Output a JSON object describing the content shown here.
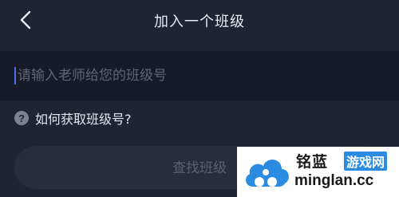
{
  "header": {
    "title": "加入一个班级",
    "back_icon": "chevron-left-icon"
  },
  "class_input": {
    "placeholder": "请输入老师给您的班级号",
    "value": ""
  },
  "help": {
    "icon": "question-circle-icon",
    "icon_glyph": "?",
    "text": "如何获取班级号?"
  },
  "search_button": {
    "label": "查找班级"
  },
  "watermark": {
    "brand": "铭蓝",
    "tag": "游戏网",
    "url": "minglan.cc"
  },
  "colors": {
    "background": "#1e2432",
    "input_band": "#161b27",
    "caret": "#4a6cf7",
    "button_bg": "#272d3b",
    "watermark_blue": "#2a8be0"
  }
}
